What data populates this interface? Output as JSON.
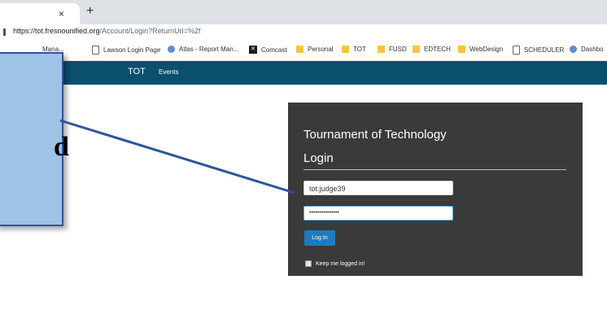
{
  "browser": {
    "tab_close": "×",
    "new_tab": "+",
    "url_host": "https://tot.fresnounified.org",
    "url_path": "/Account/Login?ReturnUrl=%2f",
    "bookmarks": [
      {
        "label": "Mana...",
        "icon": "none"
      },
      {
        "label": "Lawson Login Page",
        "icon": "page"
      },
      {
        "label": "Atlas - Report Man...",
        "icon": "atlas"
      },
      {
        "label": "Comcast",
        "icon": "comcast"
      },
      {
        "label": "Personal",
        "icon": "folder"
      },
      {
        "label": "TOT",
        "icon": "folder"
      },
      {
        "label": "FUSD",
        "icon": "folder"
      },
      {
        "label": "EDTECH",
        "icon": "folder"
      },
      {
        "label": "WebDesign",
        "icon": "folder"
      },
      {
        "label": "SCHEDULER",
        "icon": "page"
      },
      {
        "label": "Dashbo",
        "icon": "atlas"
      }
    ]
  },
  "navbar": {
    "brand": "TOT",
    "events": "Events"
  },
  "login": {
    "title": "Tournament of Technology",
    "subtitle": "Login",
    "username_value": "tot.judge39",
    "password_value": "•••••••••••••••",
    "login_button": "Log In",
    "remember_label": "Keep me logged in!"
  },
  "callout": {
    "partial_text": "d"
  },
  "colors": {
    "navbar": "#0a4f6e",
    "panel": "#3a3a3a",
    "button": "#1e7bbd",
    "callout_fill": "#9dc3e6",
    "callout_border": "#2f5597"
  }
}
